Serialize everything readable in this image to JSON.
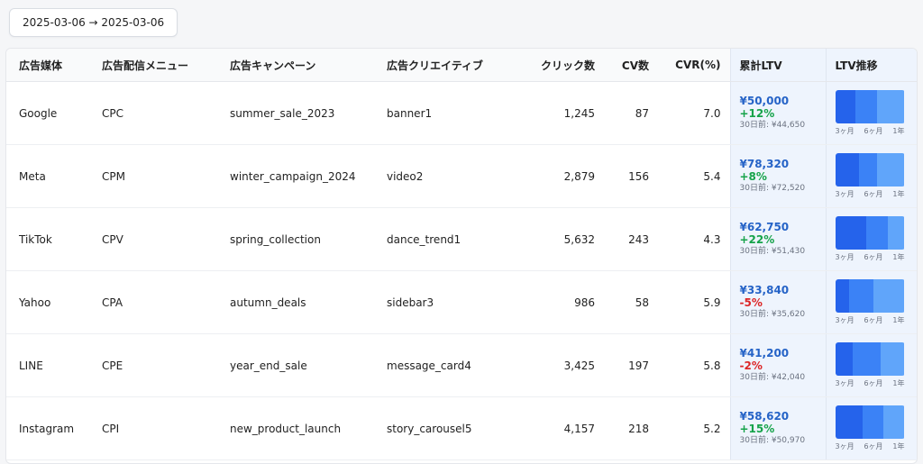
{
  "date_range": "2025-03-06 → 2025-03-06",
  "columns": {
    "media": "広告媒体",
    "menu": "広告配信メニュー",
    "campaign": "広告キャンペーン",
    "creative": "広告クリエイティブ",
    "clicks": "クリック数",
    "cv": "CV数",
    "cvr": "CVR(%)",
    "ltv": "累計LTV",
    "trend": "LTV推移"
  },
  "trend_labels": [
    "3ヶ月",
    "6ヶ月",
    "1年"
  ],
  "rows": [
    {
      "media": "Google",
      "menu": "CPC",
      "campaign": "summer_sale_2023",
      "creative": "banner1",
      "clicks": "1,245",
      "cv": "87",
      "cvr": "7.0",
      "ltv": "¥50,000",
      "change": "+12%",
      "change_dir": "pos",
      "prev": "30日前: ¥44,650",
      "trend": [
        0.29,
        0.32,
        0.39
      ]
    },
    {
      "media": "Meta",
      "menu": "CPM",
      "campaign": "winter_campaign_2024",
      "creative": "video2",
      "clicks": "2,879",
      "cv": "156",
      "cvr": "5.4",
      "ltv": "¥78,320",
      "change": "+8%",
      "change_dir": "pos",
      "prev": "30日前: ¥72,520",
      "trend": [
        0.34,
        0.26,
        0.4
      ]
    },
    {
      "media": "TikTok",
      "menu": "CPV",
      "campaign": "spring_collection",
      "creative": "dance_trend1",
      "clicks": "5,632",
      "cv": "243",
      "cvr": "4.3",
      "ltv": "¥62,750",
      "change": "+22%",
      "change_dir": "pos",
      "prev": "30日前: ¥51,430",
      "trend": [
        0.45,
        0.31,
        0.24
      ]
    },
    {
      "media": "Yahoo",
      "menu": "CPA",
      "campaign": "autumn_deals",
      "creative": "sidebar3",
      "clicks": "986",
      "cv": "58",
      "cvr": "5.9",
      "ltv": "¥33,840",
      "change": "-5%",
      "change_dir": "neg",
      "prev": "30日前: ¥35,620",
      "trend": [
        0.2,
        0.35,
        0.45
      ]
    },
    {
      "media": "LINE",
      "menu": "CPE",
      "campaign": "year_end_sale",
      "creative": "message_card4",
      "clicks": "3,425",
      "cv": "197",
      "cvr": "5.8",
      "ltv": "¥41,200",
      "change": "-2%",
      "change_dir": "neg",
      "prev": "30日前: ¥42,040",
      "trend": [
        0.25,
        0.4,
        0.35
      ]
    },
    {
      "media": "Instagram",
      "menu": "CPI",
      "campaign": "new_product_launch",
      "creative": "story_carousel5",
      "clicks": "4,157",
      "cv": "218",
      "cvr": "5.2",
      "ltv": "¥58,620",
      "change": "+15%",
      "change_dir": "pos",
      "prev": "30日前: ¥50,970",
      "trend": [
        0.39,
        0.31,
        0.3
      ]
    }
  ]
}
